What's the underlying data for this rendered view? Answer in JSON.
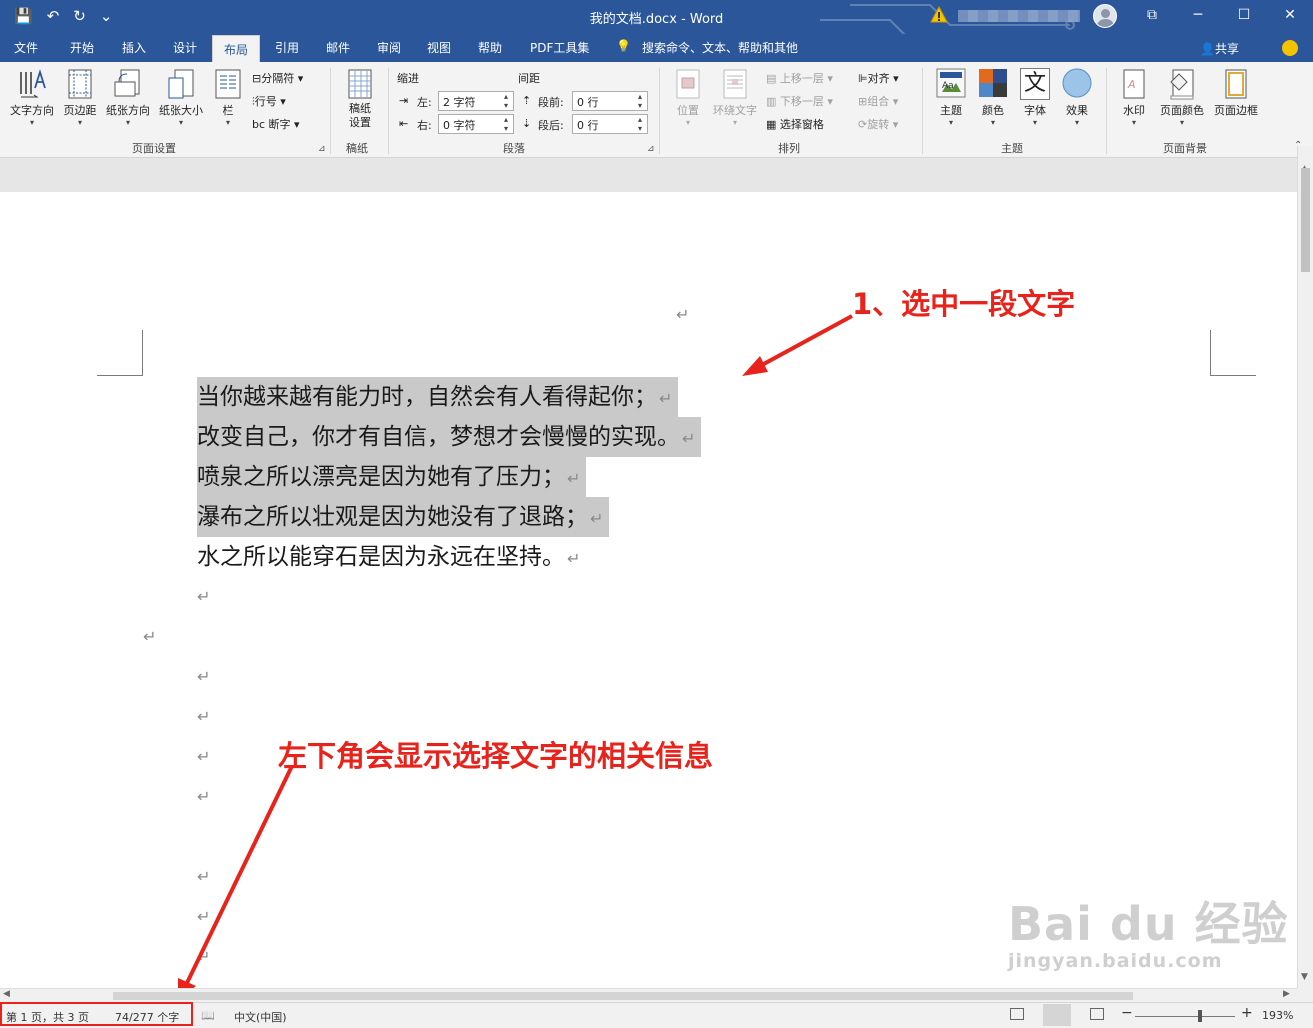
{
  "window": {
    "title": "我的文档.docx  -  Word",
    "qat": {
      "save": "💾",
      "undo": "↶",
      "redo": "↻",
      "customize": "⌄"
    },
    "controls": {
      "ribbon_display": "⧉",
      "minimize": "─",
      "maximize": "☐",
      "close": "✕"
    }
  },
  "tabs": [
    {
      "label": "文件"
    },
    {
      "label": "开始"
    },
    {
      "label": "插入"
    },
    {
      "label": "设计"
    },
    {
      "label": "布局",
      "active": true
    },
    {
      "label": "引用"
    },
    {
      "label": "邮件"
    },
    {
      "label": "审阅"
    },
    {
      "label": "视图"
    },
    {
      "label": "帮助"
    },
    {
      "label": "PDF工具集"
    }
  ],
  "search": {
    "label": "搜索命令、文本、帮助和其他"
  },
  "share": {
    "label": "共享"
  },
  "ribbon": {
    "page_setup": {
      "text_direction": "文字方向",
      "margins": "页边距",
      "orientation": "纸张方向",
      "size": "纸张大小",
      "columns": "栏",
      "breaks": "分隔符",
      "line_numbers": "行号",
      "hyphenation": "断字",
      "group_label": "页面设置"
    },
    "manuscript": {
      "button": "稿纸\n设置",
      "group_label": "稿纸"
    },
    "paragraph": {
      "indent_label": "缩进",
      "spacing_label": "间距",
      "left_label": "左:",
      "right_label": "右:",
      "before_label": "段前:",
      "after_label": "段后:",
      "left_value": "2 字符",
      "right_value": "0 字符",
      "before_value": "0 行",
      "after_value": "0 行",
      "group_label": "段落"
    },
    "arrange": {
      "position": "位置",
      "wrap_text": "环绕文字",
      "bring_forward": "上移一层",
      "send_backward": "下移一层",
      "selection_pane": "选择窗格",
      "align": "对齐",
      "group": "组合",
      "rotate": "旋转",
      "group_label": "排列"
    },
    "themes": {
      "themes": "主题",
      "colors": "颜色",
      "fonts": "字体",
      "effects": "效果",
      "group_label": "主题",
      "font_glyph": "文"
    },
    "page_background": {
      "watermark": "水印",
      "page_color": "页面颜色",
      "page_borders": "页面边框",
      "group_label": "页面背景"
    }
  },
  "document": {
    "paragraph_mark": "↵",
    "lines": [
      {
        "text": "当你越来越有能力时，自然会有人看得起你；",
        "selected": true
      },
      {
        "text": "改变自己，你才有自信，梦想才会慢慢的实现。",
        "selected": true
      },
      {
        "text": "喷泉之所以漂亮是因为她有了压力；",
        "selected": true
      },
      {
        "text": "瀑布之所以壮观是因为她没有了退路；",
        "selected": true
      },
      {
        "text": "水之所以能穿石是因为永远在坚持。",
        "selected": false
      }
    ]
  },
  "annotations": {
    "step1": "1、选中一段文字",
    "step2": "左下角会显示选择文字的相关信息"
  },
  "watermark": {
    "line1": "Bai du 经验",
    "line2": "jingyan.baidu.com"
  },
  "status": {
    "page": "第 1 页，共 3 页",
    "words": "74/277 个字",
    "language": "中文(中国)",
    "zoom": "193%",
    "zoom_fraction": 0.65
  },
  "colors": {
    "accent": "#2b579a",
    "annotation": "#e8231b",
    "selection": "#c9c9c9"
  }
}
